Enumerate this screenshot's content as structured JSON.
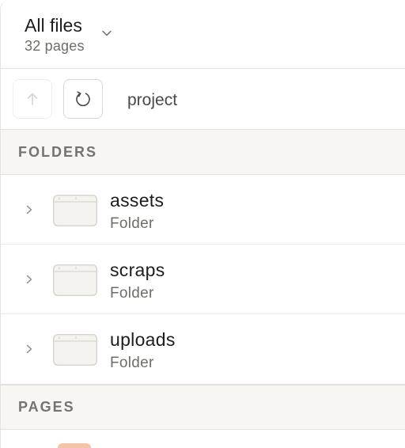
{
  "header": {
    "title": "All files",
    "subtitle": "32 pages"
  },
  "toolbar": {
    "path": "project"
  },
  "sections": {
    "folders_label": "FOLDERS",
    "pages_label": "PAGES"
  },
  "folders": [
    {
      "name": "assets",
      "kind": "Folder"
    },
    {
      "name": "scraps",
      "kind": "Folder"
    },
    {
      "name": "uploads",
      "kind": "Folder"
    }
  ],
  "colors": {
    "section_bg": "#f7f6f2",
    "text_primary": "#1d1d1d",
    "text_secondary": "#6f6d68",
    "page_thumb": "#f4c4a8"
  },
  "icons": {
    "title_chevron": "chevron-down-icon",
    "up": "arrow-up-icon",
    "refresh": "refresh-icon",
    "row_chevron": "chevron-right-icon",
    "folder": "folder-icon"
  }
}
